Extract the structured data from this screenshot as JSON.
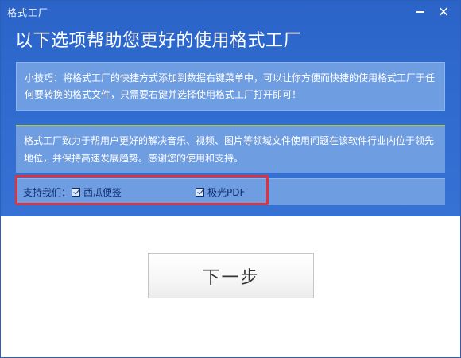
{
  "window": {
    "title": "格式工厂",
    "minimize_glyph": "",
    "close_glyph": "×"
  },
  "heading": "以下选项帮助您更好的使用格式工厂",
  "tip": "小技巧：将格式工厂的快捷方式添加到数据右键菜单中，可以让你方便而快捷的使用格式工厂于任何要转换的格式文件，只需要右键并选择使用格式工厂打开即可！",
  "info": "格式工厂致力于帮用户更好的解决音乐、视频、图片等领域文件使用问题在该软件行业内位于领先地位，并保持高速发展趋势。感谢您的使用和支持。",
  "support": {
    "label": "支持我们：",
    "options": [
      {
        "label": "西瓜便签",
        "checked": true
      },
      {
        "label": "极光PDF",
        "checked": true
      }
    ]
  },
  "next_button": "下一步",
  "colors": {
    "title_bar": "#2b63c7",
    "panel": "#6f9de2",
    "highlight": "#e0323a"
  }
}
